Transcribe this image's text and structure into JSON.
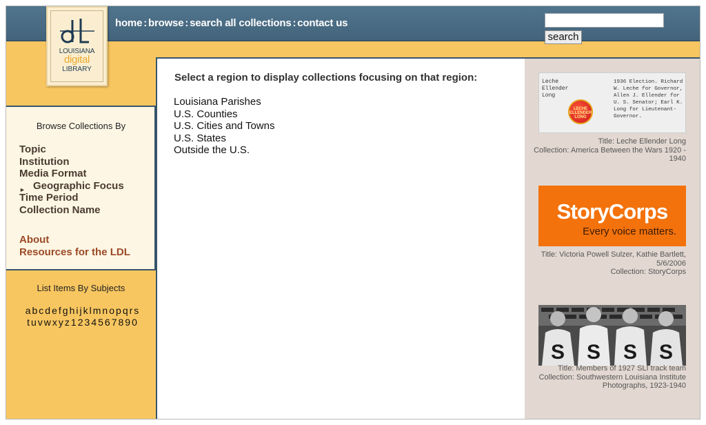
{
  "header": {
    "nav": [
      {
        "label": "home"
      },
      {
        "label": "browse"
      },
      {
        "label": "search all collections"
      },
      {
        "label": "contact us"
      }
    ],
    "nav_separator": ":",
    "search": {
      "placeholder": "",
      "value": "",
      "button_label": "search"
    },
    "colors": {
      "bar": "#4a6d84",
      "page_bg": "#f8c660",
      "panel_bg": "#fdf6e4",
      "right_bg": "#e2d8d1",
      "accent_link": "#9b4a26"
    }
  },
  "logo": {
    "line1": "LOUISIANA",
    "line2": "digital",
    "line3": "LIBRARY",
    "monogram": "dl"
  },
  "sidebar": {
    "browse_heading": "Browse Collections By",
    "items": [
      {
        "label": "Topic",
        "current": false
      },
      {
        "label": "Institution",
        "current": false
      },
      {
        "label": "Media Format",
        "current": false
      },
      {
        "label": "Geographic Focus",
        "current": true
      },
      {
        "label": "Time Period",
        "current": false
      },
      {
        "label": "Collection Name",
        "current": false
      }
    ],
    "current_marker_icon": "arrow-right-icon",
    "extra_links": [
      {
        "label": "About"
      },
      {
        "label": "Resources for the LDL"
      }
    ],
    "subjects_heading": "List Items By Subjects",
    "letters": [
      "a",
      "b",
      "c",
      "d",
      "e",
      "f",
      "g",
      "h",
      "i",
      "j",
      "k",
      "l",
      "m",
      "n",
      "o",
      "p",
      "q",
      "r",
      "s",
      "t",
      "u",
      "v",
      "w",
      "x",
      "y",
      "z",
      "1",
      "2",
      "3",
      "4",
      "5",
      "6",
      "7",
      "8",
      "9",
      "0"
    ]
  },
  "main": {
    "heading": "Select a region to display collections focusing on that region:",
    "regions": [
      {
        "label": "Louisiana Parishes"
      },
      {
        "label": "U.S. Counties"
      },
      {
        "label": "U.S. Cities and Towns"
      },
      {
        "label": "U.S. States"
      },
      {
        "label": "Outside the U.S."
      }
    ]
  },
  "featured": [
    {
      "title": "Title: Leche Ellender Long",
      "collection": "Collection: America Between the Wars 1920 - 1940",
      "thumb_text_left": "Leche\nEllender\nLong",
      "thumb_text_right": "1936 Election. Richard\nW. Leche for Governor,\nAllen J. Ellender for\nU. S. Senator; Earl K.\nLong for Lieutenant-\nGovernor.",
      "pin_text": [
        "LECHE",
        "ELLENDER",
        "LONG"
      ]
    },
    {
      "title": "Title: Victoria Powell Sulzer, Kathie Bartlett, 5/6/2006",
      "collection": "Collection: StoryCorps",
      "brand": "StoryCorps",
      "tagline": "Every voice matters."
    },
    {
      "title": "Title: Members of 1927 SLI track team",
      "collection": "Collection: Southwestern Louisiana Institute Photographs, 1923-1940",
      "jersey_letter": "S"
    }
  ]
}
